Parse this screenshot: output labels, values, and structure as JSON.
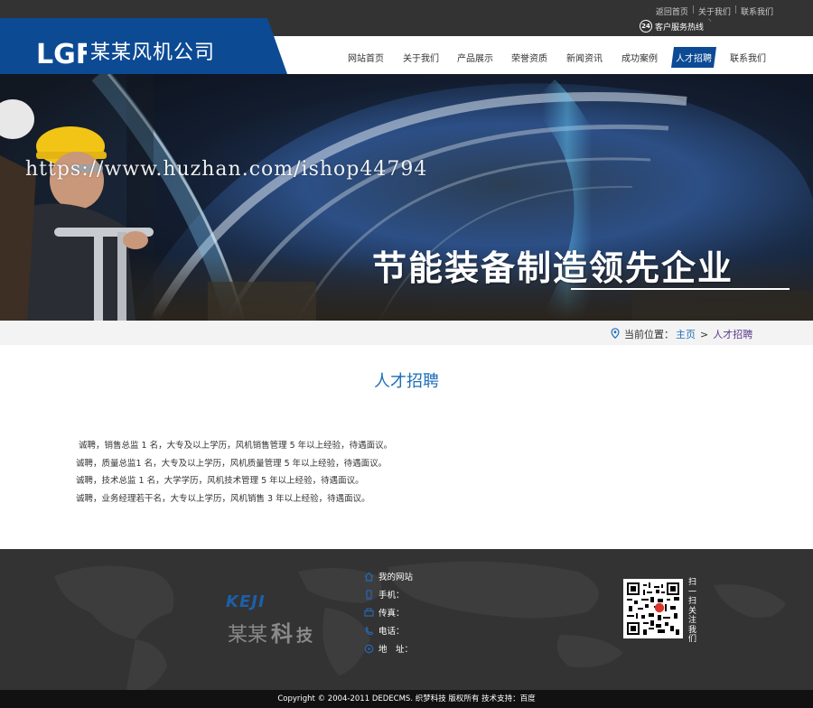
{
  "top_links": [
    "返回首页",
    "关于我们",
    "联系我们"
  ],
  "hotline_label": "客户服务热线",
  "hotline_badge": "24",
  "brand": {
    "logo_letters": "LGF",
    "name": "某某风机公司"
  },
  "nav": {
    "items": [
      "网站首页",
      "关于我们",
      "产品展示",
      "荣誉资质",
      "新闻资讯",
      "成功案例",
      "人才招聘",
      "联系我们"
    ],
    "active_index": 6
  },
  "banner": {
    "watermark": "https://www.huzhan.com/ishop44794",
    "slogan": "节能装备制造领先企业"
  },
  "breadcrumb": {
    "prefix": "当前位置：",
    "home": "主页",
    "separator": ">",
    "current": "人才招聘"
  },
  "page_title": "人才招聘",
  "jobs": [
    "诚聘，销售总监 1 名，大专及以上学历，风机销售管理 5 年以上经验，待遇面议。",
    "诚聘，质量总监1 名，大专及以上学历，风机质量管理 5 年以上经验，待遇面议。",
    "诚聘，技术总监 1 名，大学学历，风机技术管理 5 年以上经验，待遇面议。",
    "诚聘，业务经理若干名，大专以上学历，风机销售 3 年以上经验，待遇面议。"
  ],
  "footer": {
    "brand_en": "KEJI",
    "brand_cn": [
      "某某",
      "科",
      "技"
    ],
    "contact": [
      {
        "icon": "home-icon",
        "label": "我的网站"
      },
      {
        "icon": "phone-icon",
        "label": "手机："
      },
      {
        "icon": "fax-icon",
        "label": "传真："
      },
      {
        "icon": "telephone-icon",
        "label": "电话："
      },
      {
        "icon": "location-icon",
        "label": "地　址："
      }
    ],
    "qr_label": "扫一扫关注我们",
    "copyright": "Copyright © 2004-2011 DEDECMS. 织梦科技 版权所有 技术支持：百度"
  },
  "colors": {
    "brand_blue": "#0c4a94",
    "link_blue": "#1d6fb8",
    "footer_bg": "#333333"
  }
}
